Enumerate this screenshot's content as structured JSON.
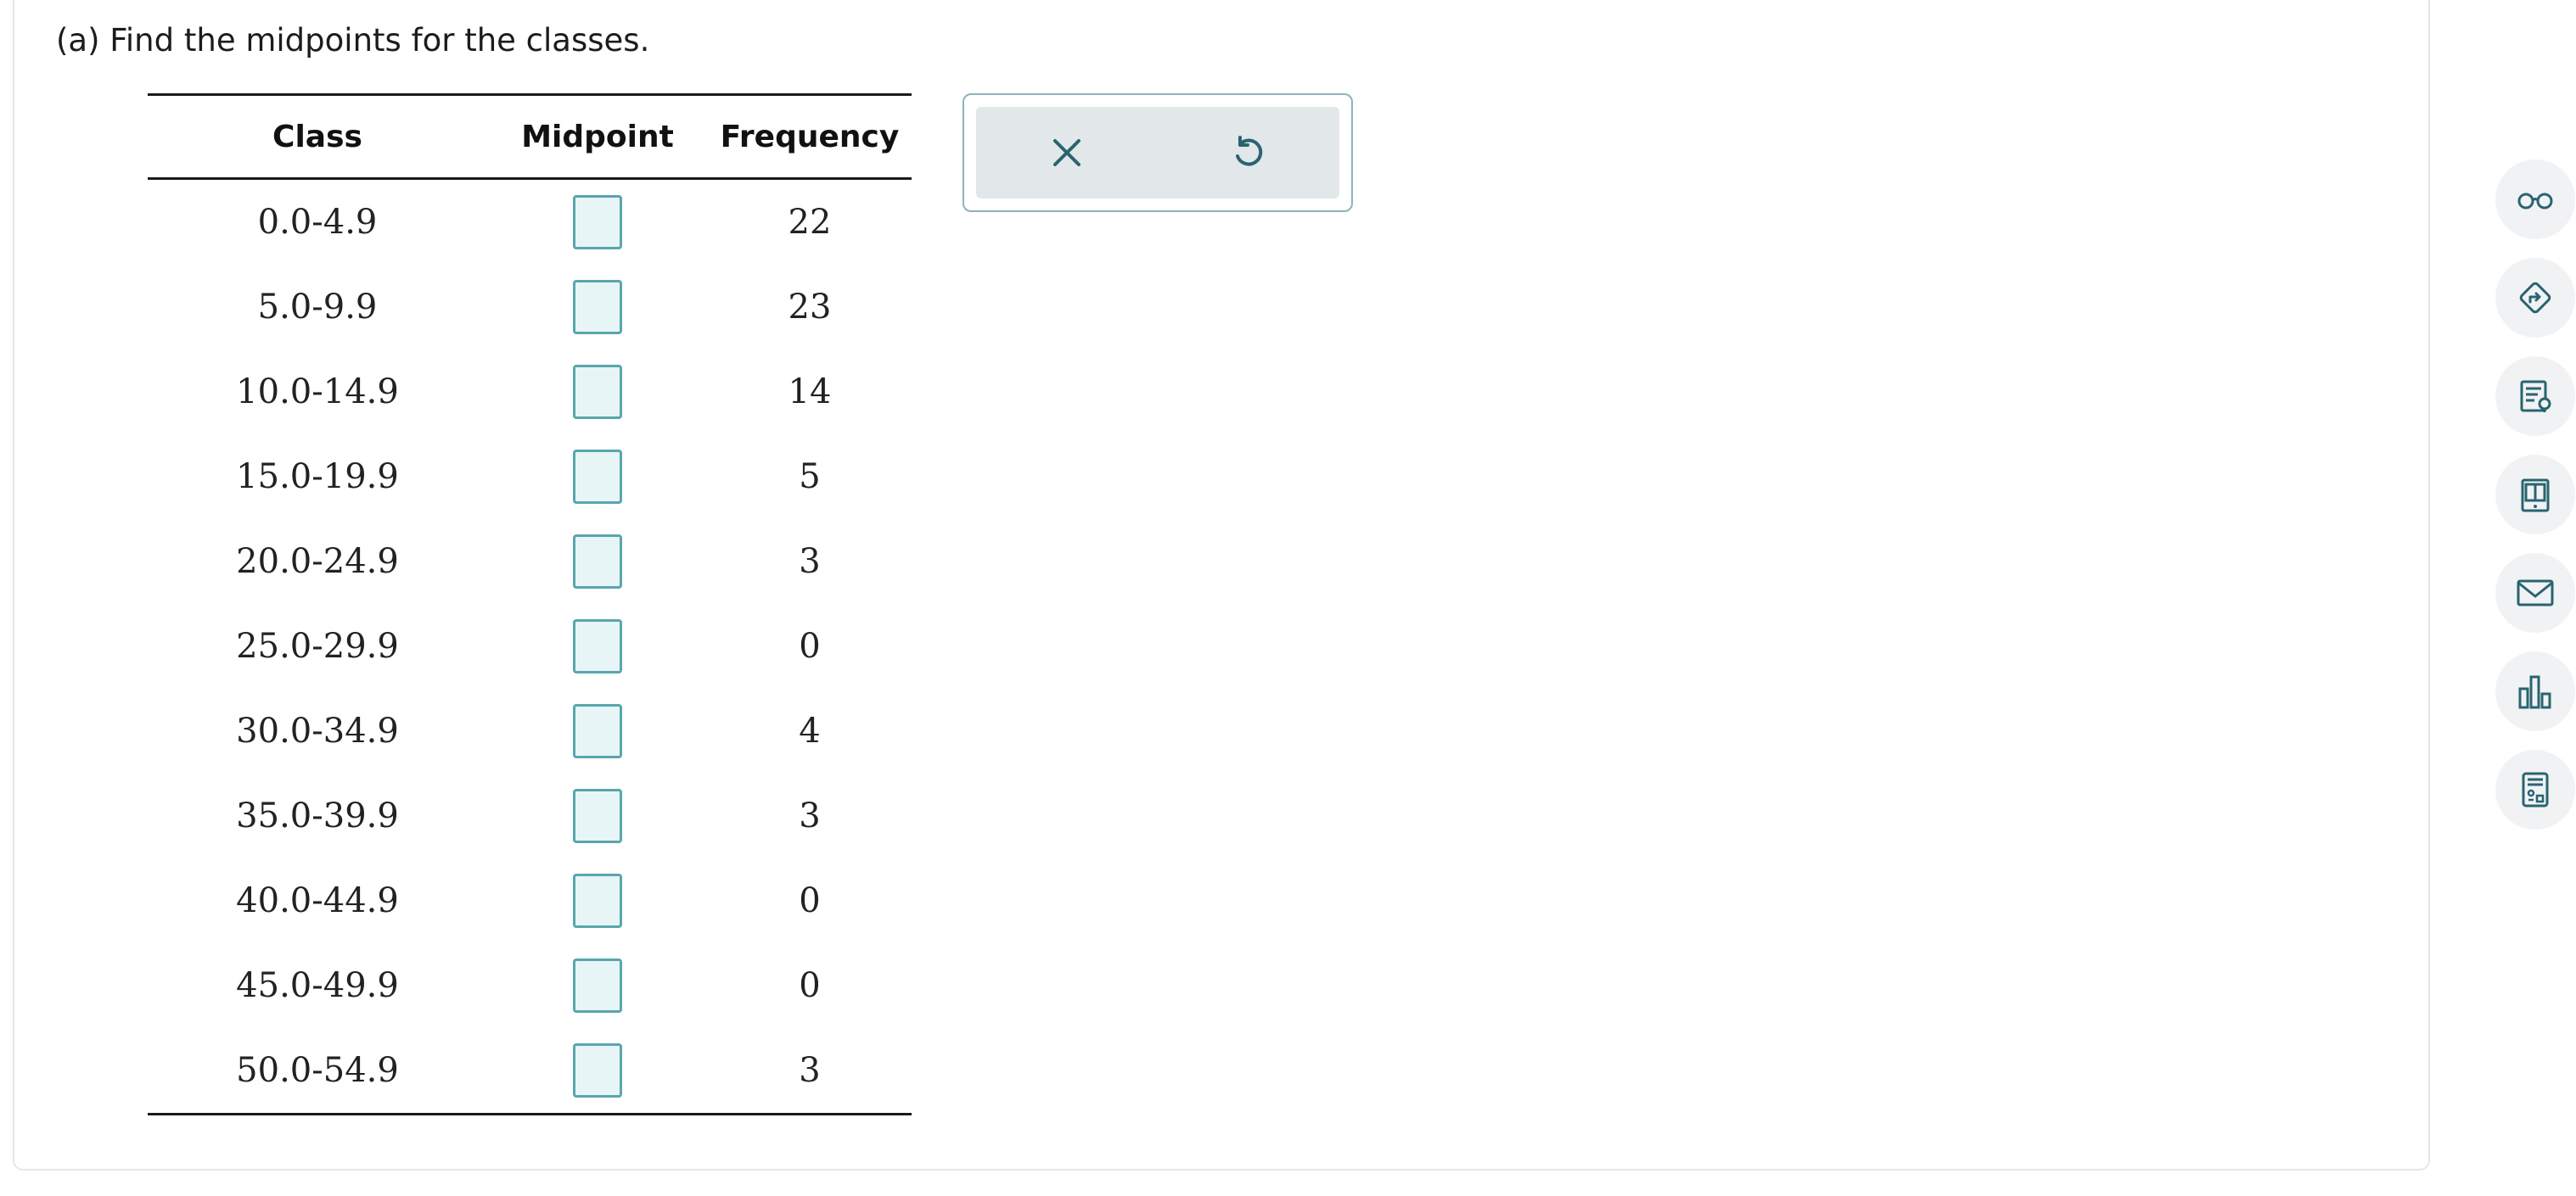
{
  "question": {
    "prompt": "(a) Find the midpoints for the classes."
  },
  "table": {
    "headers": {
      "class": "Class",
      "midpoint": "Midpoint",
      "frequency": "Frequency"
    },
    "rows": [
      {
        "class": "0.0-4.9",
        "midpoint": "",
        "frequency": "22"
      },
      {
        "class": "5.0-9.9",
        "midpoint": "",
        "frequency": "23"
      },
      {
        "class": "10.0-14.9",
        "midpoint": "",
        "frequency": "14"
      },
      {
        "class": "15.0-19.9",
        "midpoint": "",
        "frequency": "5"
      },
      {
        "class": "20.0-24.9",
        "midpoint": "",
        "frequency": "3"
      },
      {
        "class": "25.0-29.9",
        "midpoint": "",
        "frequency": "0"
      },
      {
        "class": "30.0-34.9",
        "midpoint": "",
        "frequency": "4"
      },
      {
        "class": "35.0-39.9",
        "midpoint": "",
        "frequency": "3"
      },
      {
        "class": "40.0-44.9",
        "midpoint": "",
        "frequency": "0"
      },
      {
        "class": "45.0-49.9",
        "midpoint": "",
        "frequency": "0"
      },
      {
        "class": "50.0-54.9",
        "midpoint": "",
        "frequency": "3"
      }
    ]
  },
  "answer_tools": {
    "clear_icon": "close-icon",
    "reset_icon": "undo-icon"
  },
  "side_tools": [
    {
      "icon": "glasses-icon"
    },
    {
      "icon": "directions-icon"
    },
    {
      "icon": "notes-icon"
    },
    {
      "icon": "ebook-icon"
    },
    {
      "icon": "mail-icon"
    },
    {
      "icon": "bar-chart-icon"
    },
    {
      "icon": "calculator-icon"
    }
  ],
  "colors": {
    "accent": "#2a6470",
    "input_border": "#5aa6ae",
    "input_fill": "#e8f5f7",
    "tool_bg": "#e2e8ea"
  }
}
